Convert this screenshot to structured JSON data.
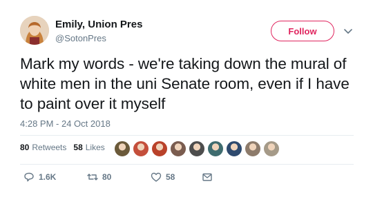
{
  "user": {
    "name": "Emily, Union Pres",
    "handle": "@SotonPres",
    "avatar_icon": "profile-avatar"
  },
  "follow": {
    "label": "Follow",
    "color": "#e0245e"
  },
  "tweet": {
    "text": "Mark my words - we're taking down the mural of white men in the uni Senate room, even if I have to paint over it myself",
    "timestamp": "4:28 PM - 24 Oct 2018"
  },
  "stats": {
    "retweets_count": "80",
    "retweets_label": "Retweets",
    "likes_count": "58",
    "likes_label": "Likes"
  },
  "likers": [
    {
      "color": "#6b5a3a"
    },
    {
      "color": "#c44f3b"
    },
    {
      "color": "#b9422a"
    },
    {
      "color": "#7a5c4f"
    },
    {
      "color": "#4d4d4d"
    },
    {
      "color": "#3f6c6f"
    },
    {
      "color": "#2e4a6e"
    },
    {
      "color": "#8d7b6b"
    },
    {
      "color": "#a59a88"
    }
  ],
  "actions": {
    "reply_count": "1.6K",
    "retweet_count": "80",
    "like_count": "58",
    "reply_icon": "reply-icon",
    "retweet_icon": "retweet-icon",
    "like_icon": "heart-icon",
    "message_icon": "envelope-icon"
  }
}
